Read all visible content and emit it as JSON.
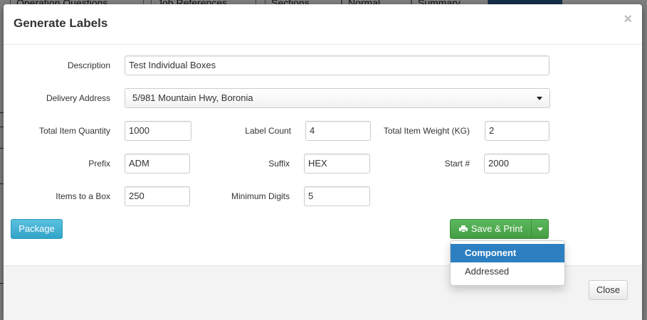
{
  "background": {
    "tabs": [
      "Operation Questions",
      "Job References",
      "Sections",
      "Normal",
      "Summary"
    ]
  },
  "modal": {
    "title": "Generate Labels",
    "close_symbol": "×",
    "fields": {
      "description": {
        "label": "Description",
        "value": "Test Individual Boxes"
      },
      "delivery_address": {
        "label": "Delivery Address",
        "value": "5/981 Mountain Hwy, Boronia"
      },
      "total_item_quantity": {
        "label": "Total Item Quantity",
        "value": "1000"
      },
      "label_count": {
        "label": "Label Count",
        "value": "4"
      },
      "total_item_weight": {
        "label": "Total Item Weight (KG)",
        "value": "2"
      },
      "prefix": {
        "label": "Prefix",
        "value": "ADM"
      },
      "suffix": {
        "label": "Suffix",
        "value": "HEX"
      },
      "start_number": {
        "label": "Start #",
        "value": "2000"
      },
      "items_to_a_box": {
        "label": "Items to a Box",
        "value": "250"
      },
      "minimum_digits": {
        "label": "Minimum Digits",
        "value": "5"
      }
    },
    "buttons": {
      "package": "Package",
      "save_print": "Save & Print",
      "close": "Close"
    },
    "dropdown": {
      "items": [
        "Component",
        "Addressed"
      ],
      "selected": "Component"
    },
    "icons": {
      "save_print": "printer-icon",
      "dropdown_toggle": "caret-down-icon"
    },
    "colors": {
      "package_button": "#31a4c9",
      "save_print_button": "#449d44",
      "dropdown_highlight": "#2c7fc1"
    }
  }
}
